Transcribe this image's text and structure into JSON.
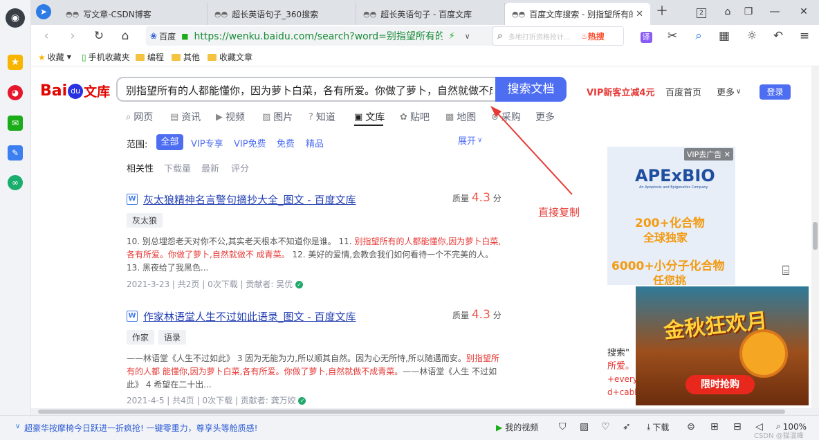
{
  "tabs": [
    {
      "title": "写文章-CSDN博客"
    },
    {
      "title": "超长英语句子_360搜索"
    },
    {
      "title": "超长英语句子 - 百度文库"
    },
    {
      "title": "百度文库搜索 - 别指望所有的人"
    }
  ],
  "tab_counter": "2",
  "address": {
    "site": "百度",
    "url": "https://wenku.baidu.com/search?word=别指望所有的人"
  },
  "side_search": {
    "placeholder": "多地打折资格抢计...",
    "hot_label": "热搜"
  },
  "toolbar_translate": "译",
  "bookmarks": [
    "收藏",
    "手机收藏夹",
    "编程",
    "其他",
    "收藏文章"
  ],
  "page": {
    "logo_bai": "Bai",
    "logo_du": "du",
    "logo_wenku": "文库",
    "query": "别指望所有的人都能懂你，因为萝卜白菜，各有所爱。你做了萝卜，自然就做不成",
    "search_button": "搜索文档",
    "vip_promo": "VIP新客立减4元",
    "home_link": "百度首页",
    "more_link": "更多",
    "login_button": "登录",
    "nav_tabs": [
      "网页",
      "资讯",
      "视频",
      "图片",
      "知道",
      "文库",
      "贴吧",
      "地图",
      "采购",
      "更多"
    ],
    "scope_label": "范围:",
    "scope_chips": [
      "全部",
      "VIP专享",
      "VIP免费",
      "免费",
      "精品"
    ],
    "expand_label": "展开",
    "sort_options": [
      "相关性",
      "下载量",
      "最新",
      "评分"
    ],
    "annotation": "直接复制",
    "results": [
      {
        "title": "灰太狼精神名言警句摘抄大全_图文 - 百度文库",
        "score_label": "质量",
        "score": "4.3",
        "score_unit": "分",
        "tags": [
          "灰太狼"
        ],
        "snippet_parts": [
          {
            "text": "10. 别总埋怨老天对你不公,其实老天根本不知道你是谁。 11. ",
            "red": false
          },
          {
            "text": "别指望所有的人都能懂你,因为萝卜白菜,各有所爱。你做了萝卜,自然就做不 成青菜。",
            "red": true
          },
          {
            "text": " 12. 美好的爱情,会教会我们如何看待一个不完美的人。 13. 黑夜给了我黑色...",
            "red": false
          }
        ],
        "date": "2021-3-23",
        "pages": "共2页",
        "downloads": "0次下载",
        "contributor_label": "贡献者:",
        "contributor": "吴优"
      },
      {
        "title": "作家林语堂人生不过如此语录_图文 - 百度文库",
        "score_label": "质量",
        "score": "4.3",
        "score_unit": "分",
        "tags": [
          "作家",
          "语录"
        ],
        "snippet_parts": [
          {
            "text": "——林语堂《人生不过如此》 3 因为无能为力,所以顺其自然。因为心无所恃,所以随遇而安。",
            "red": false
          },
          {
            "text": "别指望所有的人都 能懂你,因为萝卜白菜,各有所爱。你做了萝卜,自然就做不成青菜。",
            "red": true
          },
          {
            "text": "——林语堂《人生 不过如此》 4 希望在二十出...",
            "red": false
          }
        ],
        "date": "2021-4-5",
        "pages": "共4页",
        "downloads": "0次下载",
        "contributor_label": "贡献者:",
        "contributor": "龚万姣"
      }
    ],
    "ad1": {
      "close_label": "VIP去广告",
      "brand": "APExBIO",
      "tagline": "An Apoptosis and Epigenetics Company",
      "line1": "200+化合物",
      "line2": "全球独家",
      "line3": "6000+小分子化合物",
      "line4": "任您挑"
    },
    "ad2": {
      "title": "金秋狂欢月",
      "button": "限时抢购"
    },
    "side_snippet": {
      "line1": "搜索\"",
      "line2": "所爱。",
      "line3": "+every",
      "line4": "d+cabb"
    }
  },
  "statusbar": {
    "news": "超豪华按摩椅今日跃进一折疯抢! 一键零重力，尊享头等舱质感!",
    "video": "我的视频",
    "download": "下载",
    "zoom": "100%",
    "watermark": "CSDN @猫温峰"
  }
}
